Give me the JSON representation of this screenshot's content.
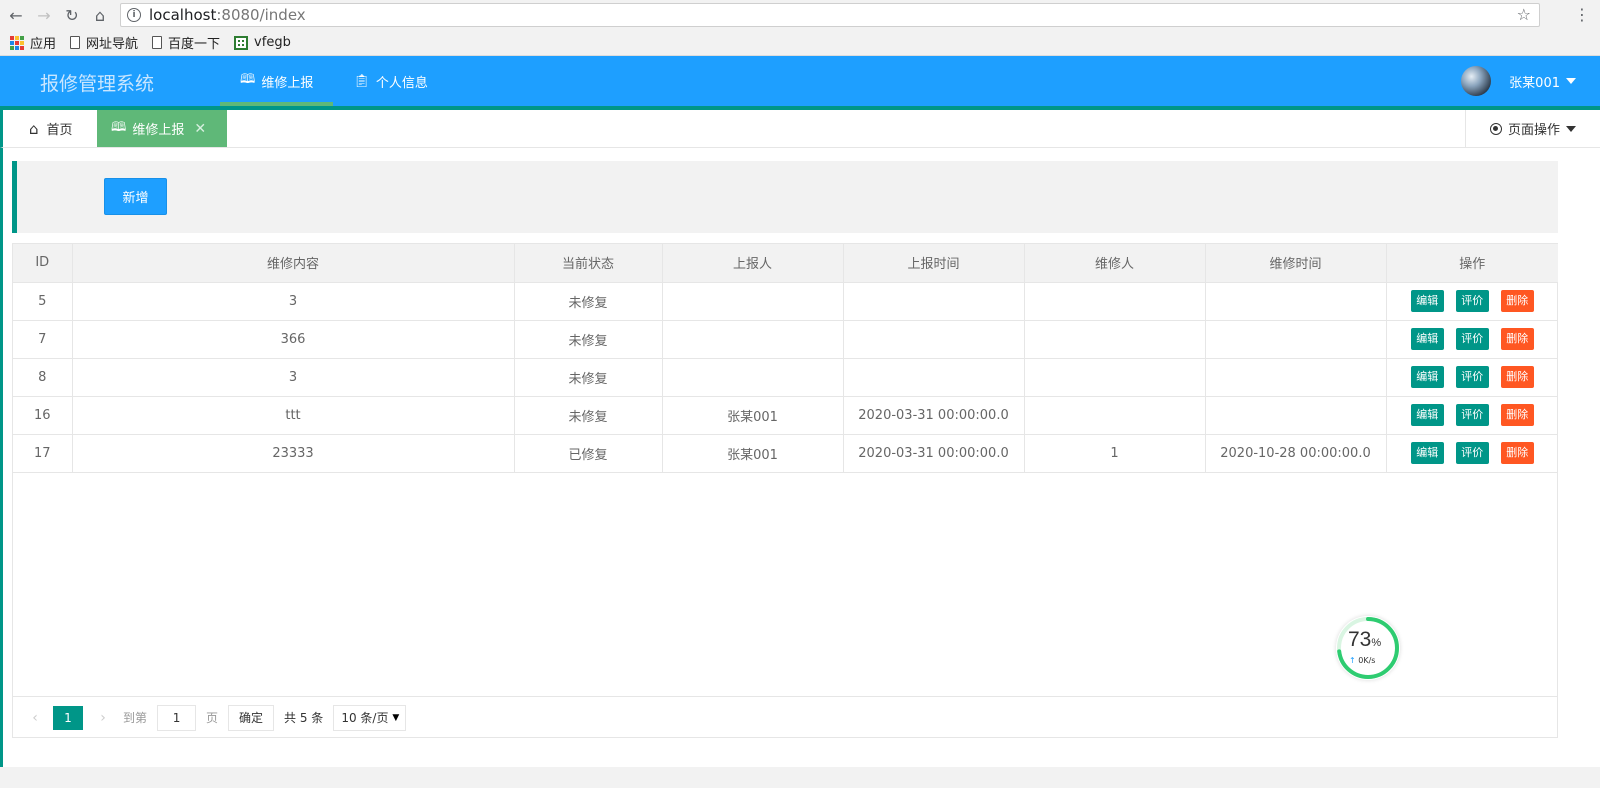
{
  "browser": {
    "url_host": "localhost",
    "url_rest": ":8080/index",
    "bookmarks": [
      {
        "label": "应用",
        "icon": "apps-grid-icon"
      },
      {
        "label": "网址导航",
        "icon": "page-icon"
      },
      {
        "label": "百度一下",
        "icon": "page-icon"
      },
      {
        "label": "vfegb",
        "icon": "qr-icon"
      }
    ]
  },
  "header": {
    "logo": "报修管理系统",
    "nav": [
      {
        "label": "维修上报",
        "icon": "book-icon",
        "active": true
      },
      {
        "label": "个人信息",
        "icon": "clipboard-icon",
        "active": false
      }
    ],
    "user_name": "张某001"
  },
  "tabs": {
    "home_label": "首页",
    "active_label": "维修上报",
    "page_ops_label": "页面操作"
  },
  "toolbar": {
    "add_label": "新增"
  },
  "table": {
    "columns": [
      "ID",
      "维修内容",
      "当前状态",
      "上报人",
      "上报时间",
      "维修人",
      "维修时间",
      "操作"
    ],
    "rows": [
      {
        "id": "5",
        "content": "3",
        "status": "未修复",
        "reporter": "",
        "report_time": "",
        "repairer": "",
        "repair_time": ""
      },
      {
        "id": "7",
        "content": "366",
        "status": "未修复",
        "reporter": "",
        "report_time": "",
        "repairer": "",
        "repair_time": ""
      },
      {
        "id": "8",
        "content": "3",
        "status": "未修复",
        "reporter": "",
        "report_time": "",
        "repairer": "",
        "repair_time": ""
      },
      {
        "id": "16",
        "content": "ttt",
        "status": "未修复",
        "reporter": "张某001",
        "report_time": "2020-03-31 00:00:00.0",
        "repairer": "",
        "repair_time": ""
      },
      {
        "id": "17",
        "content": "23333",
        "status": "已修复",
        "reporter": "张某001",
        "report_time": "2020-03-31 00:00:00.0",
        "repairer": "1",
        "repair_time": "2020-10-28 00:00:00.0"
      }
    ],
    "ops": {
      "edit": "编辑",
      "rate": "评价",
      "delete": "删除"
    }
  },
  "pager": {
    "current": "1",
    "goto_label": "到第",
    "goto_value": "1",
    "page_label": "页",
    "confirm_label": "确定",
    "total": "共 5 条",
    "page_size": "10 条/页"
  },
  "speed_widget": {
    "percent": 73,
    "rate": "0K/s"
  },
  "colors": {
    "header_blue": "#1e9fff",
    "accent_green": "#009688",
    "tab_green": "#5fb878",
    "danger": "#ff5722"
  }
}
